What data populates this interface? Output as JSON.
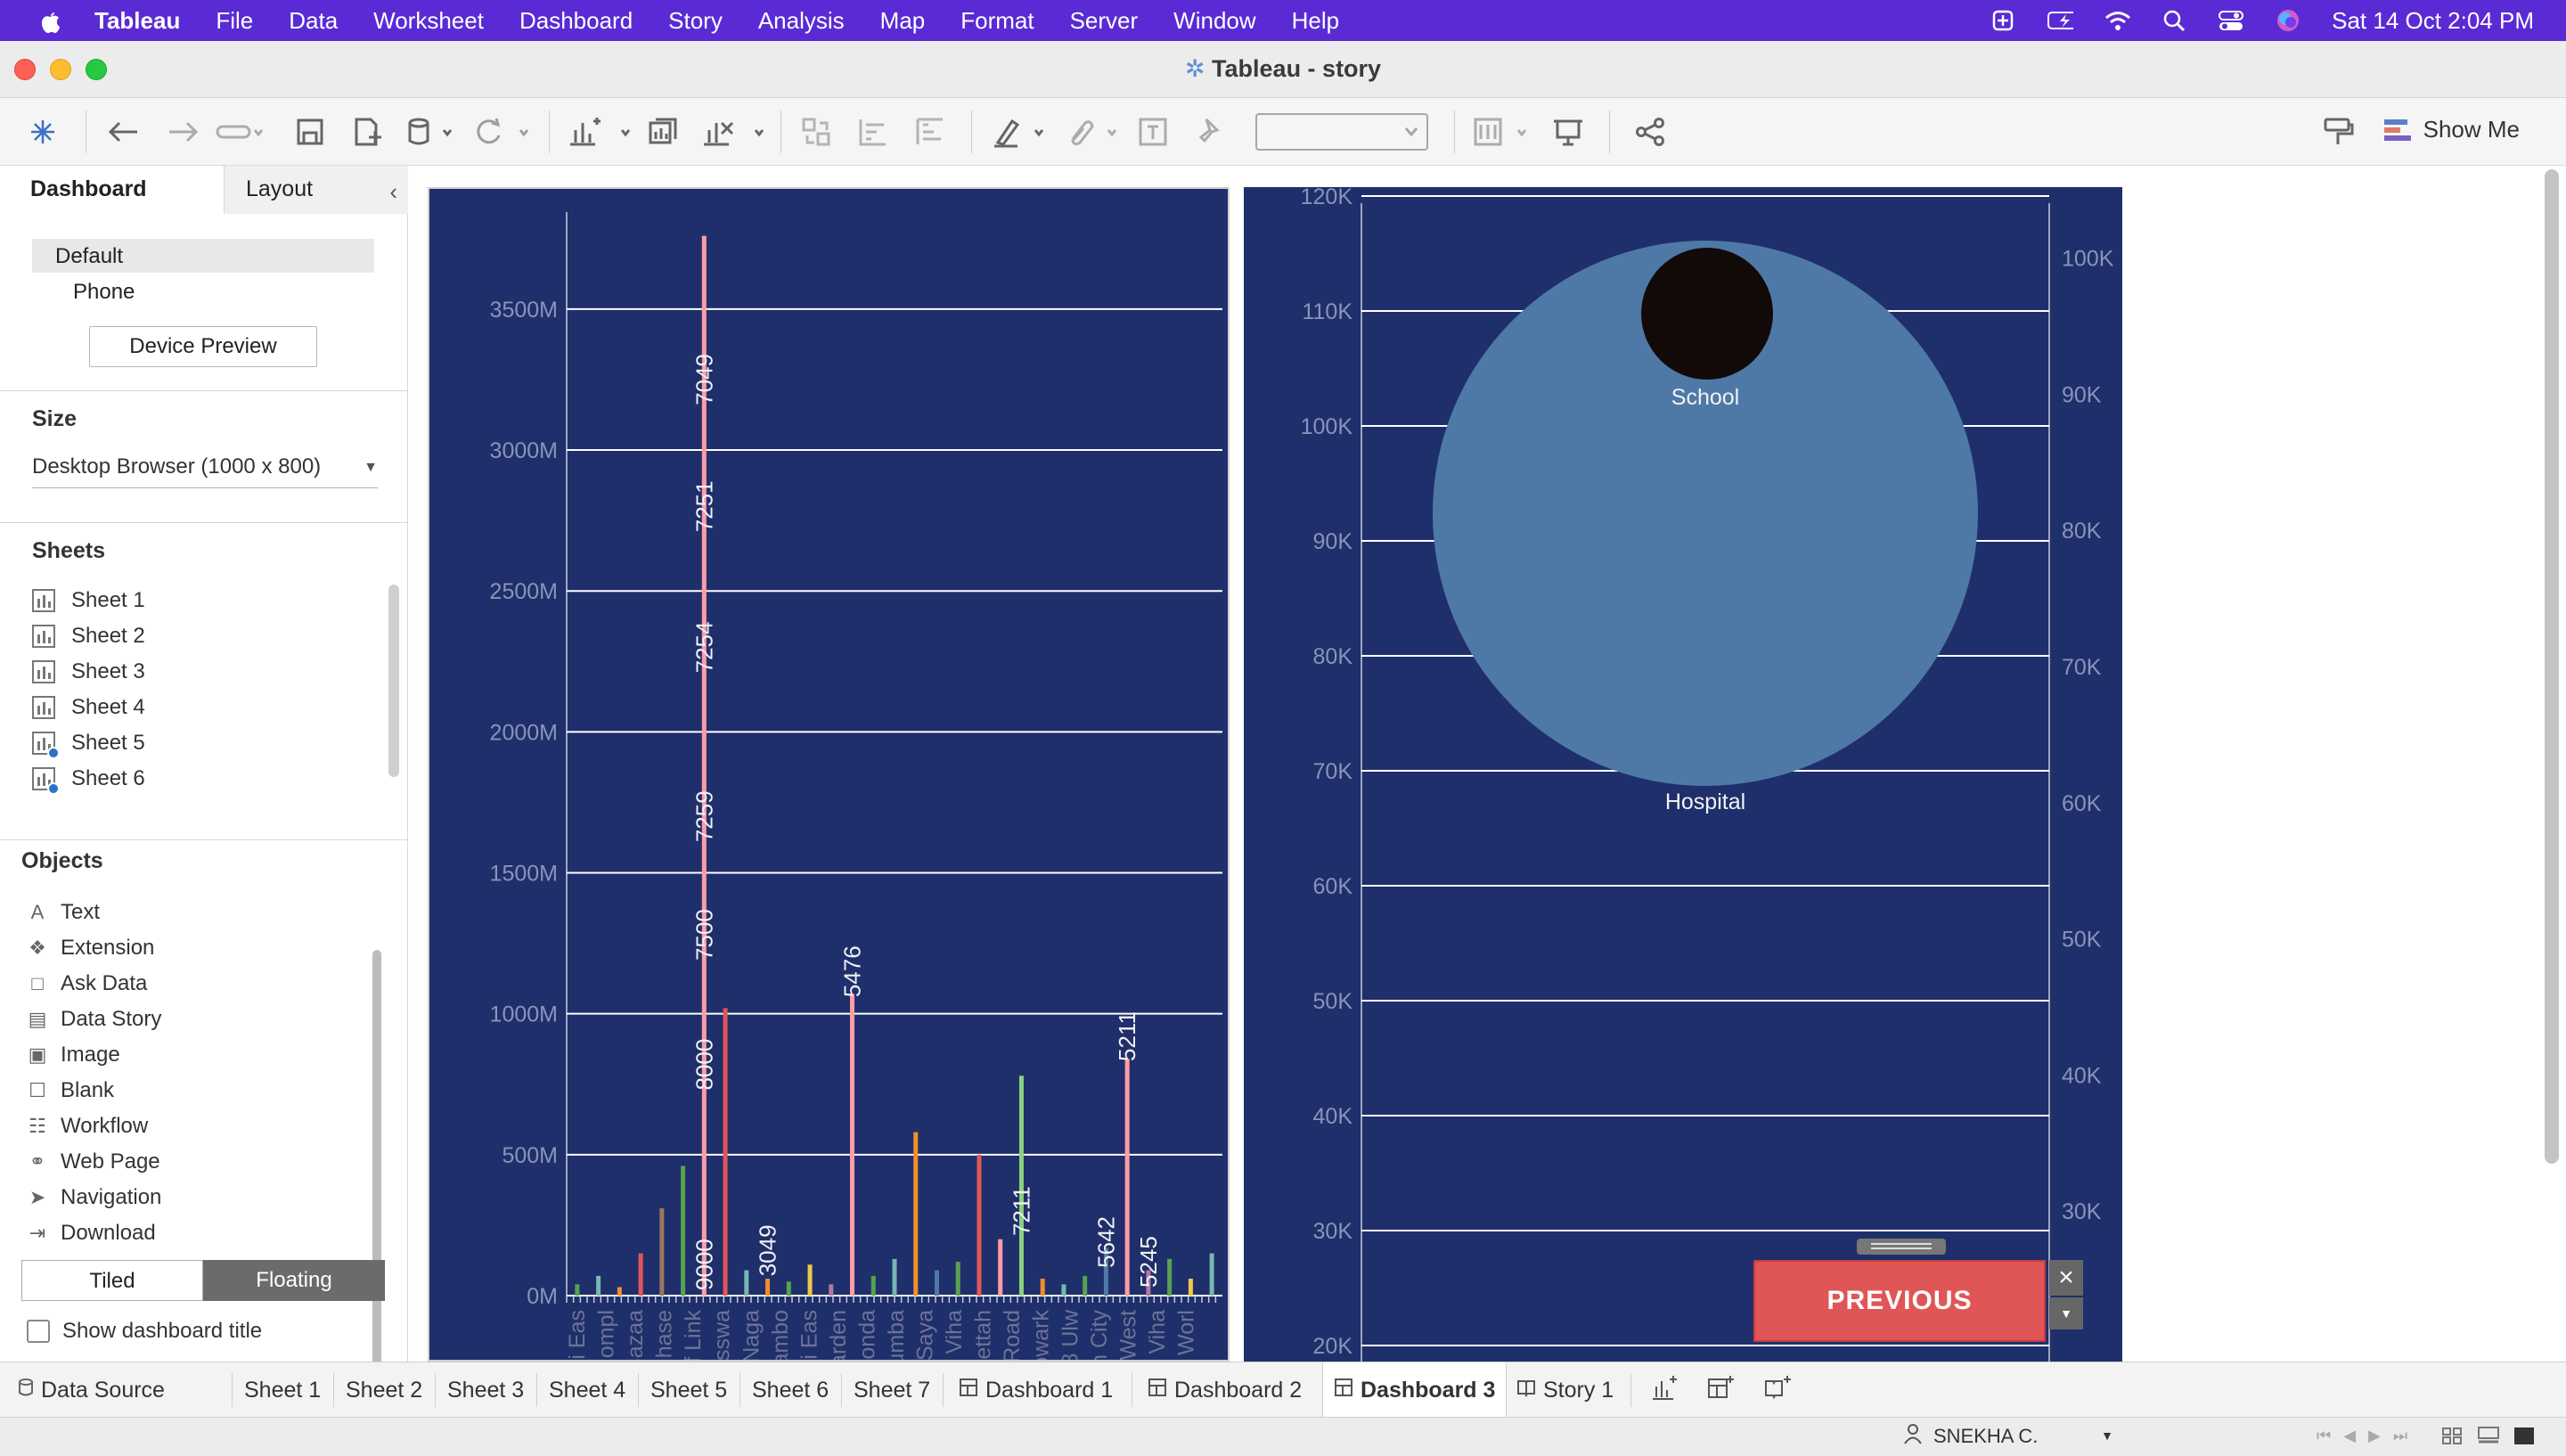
{
  "menubar": {
    "app": "Tableau",
    "items": [
      "File",
      "Data",
      "Worksheet",
      "Dashboard",
      "Story",
      "Analysis",
      "Map",
      "Format",
      "Server",
      "Window",
      "Help"
    ],
    "clock": "Sat 14 Oct  2:04 PM"
  },
  "window": {
    "title": "Tableau - story"
  },
  "toolbar": {
    "show_me": "Show Me"
  },
  "leftpane": {
    "tab_dashboard": "Dashboard",
    "tab_layout": "Layout",
    "devices": [
      "Default",
      "Phone"
    ],
    "device_preview": "Device Preview",
    "size_title": "Size",
    "size_value": "Desktop Browser (1000 x 800)",
    "sheets_title": "Sheets",
    "sheets": [
      "Sheet 1",
      "Sheet 2",
      "Sheet 3",
      "Sheet 4",
      "Sheet 5",
      "Sheet 6"
    ],
    "objects_title": "Objects",
    "objects": [
      "Text",
      "Extension",
      "Ask Data",
      "Data Story",
      "Image",
      "Blank",
      "Workflow",
      "Web Page",
      "Navigation",
      "Download"
    ],
    "tiled": "Tiled",
    "floating": "Floating",
    "show_title": "Show dashboard title"
  },
  "chart_data": [
    {
      "type": "bar",
      "y_tick_labels": [
        "0M",
        "500M",
        "1000M",
        "1500M",
        "2000M",
        "2500M",
        "3000M",
        "3500M"
      ],
      "ylim": [
        0,
        3800
      ],
      "grid": true,
      "x_tick_labels": [
        "ri Eas",
        "ompl",
        "Bazaa",
        "hase",
        "f Link",
        "asswa",
        "Naga",
        "ambo",
        "ali Eas",
        "arden",
        "ikonda",
        "humba",
        "a Saya",
        "t Viha",
        "pettah",
        "e Road",
        "owark",
        "8 Ulw",
        "un City",
        "e West",
        "t Viha",
        "Worl"
      ],
      "data_labels": [
        {
          "x": 7,
          "y": 3250,
          "text": "7049"
        },
        {
          "x": 7,
          "y": 2800,
          "text": "7251"
        },
        {
          "x": 7,
          "y": 2300,
          "text": "7254"
        },
        {
          "x": 7,
          "y": 1700,
          "text": "7259"
        },
        {
          "x": 7,
          "y": 1280,
          "text": "7500"
        },
        {
          "x": 7,
          "y": 820,
          "text": "8000"
        },
        {
          "x": 7,
          "y": 110,
          "text": "9000"
        },
        {
          "x": 10,
          "y": 160,
          "text": "3049"
        },
        {
          "x": 14,
          "y": 1150,
          "text": "5476"
        },
        {
          "x": 22,
          "y": 300,
          "text": "7211"
        },
        {
          "x": 26,
          "y": 190,
          "text": "5642"
        },
        {
          "x": 27,
          "y": 920,
          "text": "5211"
        },
        {
          "x": 28,
          "y": 120,
          "text": "5245"
        }
      ],
      "bars": [
        {
          "x": 1,
          "value": 40,
          "color": "#59a14f"
        },
        {
          "x": 2,
          "value": 70,
          "color": "#76b7b2"
        },
        {
          "x": 3,
          "value": 30,
          "color": "#f28e2b"
        },
        {
          "x": 4,
          "value": 150,
          "color": "#e15759"
        },
        {
          "x": 5,
          "value": 310,
          "color": "#9c755f"
        },
        {
          "x": 6,
          "value": 460,
          "color": "#59a14f"
        },
        {
          "x": 7,
          "value": 3760,
          "color": "#ff9da7"
        },
        {
          "x": 8,
          "value": 1020,
          "color": "#e15759"
        },
        {
          "x": 9,
          "value": 90,
          "color": "#76b7b2"
        },
        {
          "x": 10,
          "value": 60,
          "color": "#f28e2b"
        },
        {
          "x": 11,
          "value": 50,
          "color": "#59a14f"
        },
        {
          "x": 12,
          "value": 110,
          "color": "#edc948"
        },
        {
          "x": 13,
          "value": 40,
          "color": "#b07aa1"
        },
        {
          "x": 14,
          "value": 1070,
          "color": "#ff9da7"
        },
        {
          "x": 15,
          "value": 70,
          "color": "#59a14f"
        },
        {
          "x": 16,
          "value": 130,
          "color": "#76b7b2"
        },
        {
          "x": 17,
          "value": 580,
          "color": "#f28e2b"
        },
        {
          "x": 18,
          "value": 90,
          "color": "#4e79a7"
        },
        {
          "x": 19,
          "value": 120,
          "color": "#59a14f"
        },
        {
          "x": 20,
          "value": 500,
          "color": "#e15759"
        },
        {
          "x": 21,
          "value": 200,
          "color": "#ff9da7"
        },
        {
          "x": 22,
          "value": 780,
          "color": "#8cd17d"
        },
        {
          "x": 23,
          "value": 60,
          "color": "#f28e2b"
        },
        {
          "x": 24,
          "value": 40,
          "color": "#76b7b2"
        },
        {
          "x": 25,
          "value": 70,
          "color": "#59a14f"
        },
        {
          "x": 26,
          "value": 170,
          "color": "#4e79a7"
        },
        {
          "x": 27,
          "value": 840,
          "color": "#ff9da7"
        },
        {
          "x": 28,
          "value": 90,
          "color": "#b07aa1"
        },
        {
          "x": 29,
          "value": 130,
          "color": "#59a14f"
        },
        {
          "x": 30,
          "value": 60,
          "color": "#edc948"
        },
        {
          "x": 31,
          "value": 150,
          "color": "#76b7b2"
        }
      ]
    },
    {
      "type": "scatter",
      "y_left_ticks": [
        "20K",
        "30K",
        "40K",
        "50K",
        "60K",
        "70K",
        "80K",
        "90K",
        "100K",
        "110K",
        "120K"
      ],
      "y_left_range": [
        20,
        120
      ],
      "y_right_ticks": [
        "30K",
        "40K",
        "50K",
        "60K",
        "70K",
        "80K",
        "90K",
        "100K"
      ],
      "y_right_range": [
        20,
        100
      ],
      "grid": true,
      "points": [
        {
          "label": "Hospital",
          "y": 89,
          "size": "large",
          "color": "#4e79a7"
        },
        {
          "label": "School",
          "y": 111,
          "size": "small",
          "color": "#120a08"
        }
      ]
    }
  ],
  "previous_button": "PREVIOUS",
  "bottom_tabs": [
    "Data Source",
    "Sheet 1",
    "Sheet 2",
    "Sheet 3",
    "Sheet 4",
    "Sheet 5",
    "Sheet 6",
    "Sheet 7",
    "Dashboard 1",
    "Dashboard 2",
    "Dashboard 3",
    "Story 1"
  ],
  "active_tab": "Dashboard 3",
  "status": {
    "user": "SNEKHA C."
  },
  "colors": {
    "dashboard_bg": "#1f2f6b",
    "menubar": "#5a2bd4",
    "previous": "#e05555"
  }
}
